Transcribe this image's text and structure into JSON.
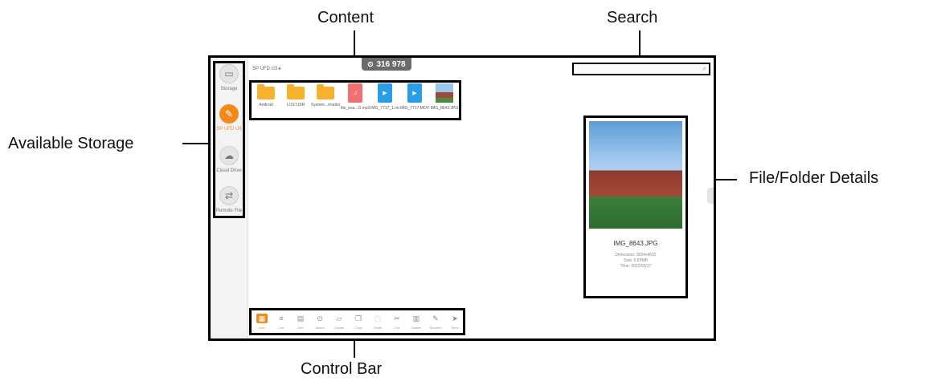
{
  "callouts": {
    "content": "Content",
    "search": "Search",
    "available_storage": "Available Storage",
    "details": "File/Folder Details",
    "control_bar": "Control Bar"
  },
  "sidebar": {
    "items": [
      {
        "label": "Storage",
        "icon": "drive-icon"
      },
      {
        "label": "SP UFD U3",
        "icon": "usb-icon",
        "active": true
      },
      {
        "label": "Cloud Drive",
        "icon": "cloud-icon"
      },
      {
        "label": "Remote File",
        "icon": "transfer-icon"
      }
    ]
  },
  "breadcrumb": "SP UFD U3 ▸",
  "counter": "316 978",
  "files": [
    {
      "name": "Android",
      "kind": "folder"
    },
    {
      "name": "LOST.DIR",
      "kind": "folder"
    },
    {
      "name": "System...rmation",
      "kind": "folder"
    },
    {
      "name": "file_exa...G.mp3",
      "kind": "music"
    },
    {
      "name": "IMG_7717_1.mov",
      "kind": "video"
    },
    {
      "name": "IMG_7717.MOV",
      "kind": "video"
    },
    {
      "name": "IMG_8643.JPG",
      "kind": "image"
    }
  ],
  "details": {
    "name": "IMG_8643.JPG",
    "dimension": "Dimension: 3024x4032",
    "size": "Size: 5.55MB",
    "time": "Time: 2022/02/17"
  },
  "controls": [
    {
      "label": "Icon",
      "active": true
    },
    {
      "label": "List"
    },
    {
      "label": "Sort"
    },
    {
      "label": "Select"
    },
    {
      "label": "Create"
    },
    {
      "label": "Copy"
    },
    {
      "label": "Paste"
    },
    {
      "label": "Cut"
    },
    {
      "label": "Delete"
    },
    {
      "label": "Rename"
    },
    {
      "label": "Send"
    }
  ],
  "colors": {
    "accent": "#f28a1b",
    "folder": "#f6b22c",
    "music": "#f07070",
    "video": "#2a9de8"
  }
}
